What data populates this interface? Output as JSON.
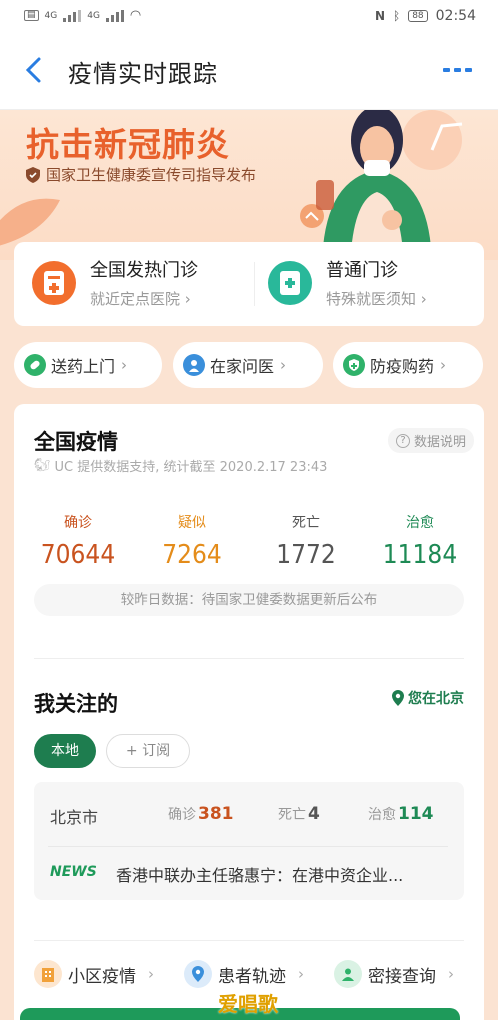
{
  "status": {
    "net1": "4G",
    "net2": "4G",
    "battery": "88",
    "time": "02:54"
  },
  "nav": {
    "title": "疫情实时跟踪"
  },
  "banner": {
    "title": "抗击新冠肺炎",
    "subtitle": "国家卫生健康委宣传司指导发布"
  },
  "clinics": [
    {
      "name": "全国发热门诊",
      "desc": "就近定点医院 ›"
    },
    {
      "name": "普通门诊",
      "desc": "特殊就医须知 ›"
    }
  ],
  "pills": [
    {
      "label": "送药上门",
      "color": "#2fb26a"
    },
    {
      "label": "在家问医",
      "color": "#3a8fdb"
    },
    {
      "label": "防疫购药",
      "color": "#2fb26a"
    }
  ],
  "national": {
    "title": "全国疫情",
    "note": "数据说明",
    "source": "UC 提供数据支持, 统计截至 2020.2.17 23:43",
    "stats": [
      {
        "label": "确诊",
        "value": "70644",
        "color": "#c9531f"
      },
      {
        "label": "疑似",
        "value": "7264",
        "color": "#e48c1a"
      },
      {
        "label": "死亡",
        "value": "1772",
        "color": "#555555"
      },
      {
        "label": "治愈",
        "value": "11184",
        "color": "#1e8a55"
      }
    ],
    "compare": "较昨日数据：待国家卫健委数据更新后公布"
  },
  "follow": {
    "title": "我关注的",
    "location": "您在北京",
    "tab_local": "本地",
    "tab_subscribe": "+ 订阅",
    "city": "北京市",
    "confirmed_label": "确诊",
    "confirmed": "381",
    "death_label": "死亡",
    "death": "4",
    "cured_label": "治愈",
    "cured": "114",
    "news_badge": "NEWS",
    "news": "香港中联办主任骆惠宁：在港中资企业..."
  },
  "quick": [
    {
      "label": "小区疫情",
      "color": "#f1a13a"
    },
    {
      "label": "患者轨迹",
      "color": "#3a8fdb"
    },
    {
      "label": "密接查询",
      "color": "#2fb26a"
    }
  ],
  "watermark": "爱唱歌"
}
